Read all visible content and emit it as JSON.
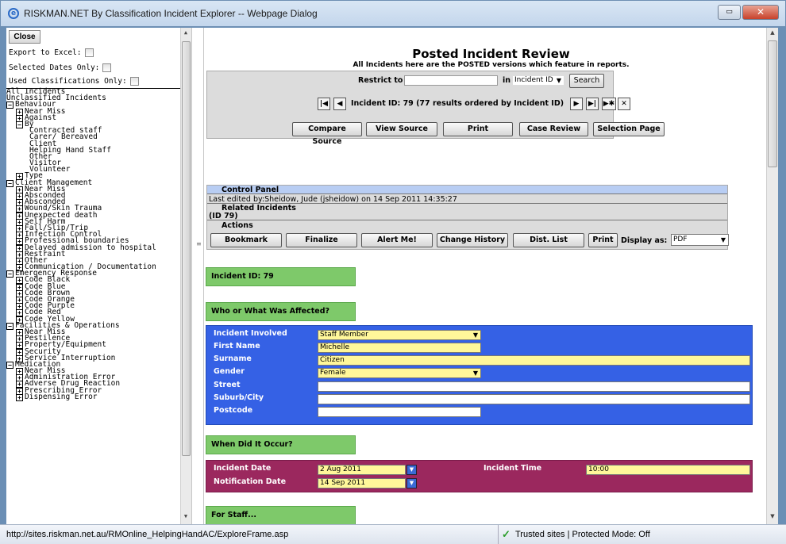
{
  "window": {
    "title": "RISKMAN.NET By Classification Incident Explorer -- Webpage Dialog",
    "close_symbol": "✕",
    "restore_symbol": "▭"
  },
  "left": {
    "close_label": "Close",
    "options": [
      "Export to Excel:",
      "Selected Dates Only:",
      "Used Classifications Only:"
    ],
    "tree": [
      {
        "t": "All Incidents",
        "lv": 0,
        "ex": ""
      },
      {
        "t": "Unclassified Incidents",
        "lv": 0,
        "ex": ""
      },
      {
        "t": "Behaviour",
        "lv": 0,
        "ex": "−"
      },
      {
        "t": "Near Miss",
        "lv": 1,
        "ex": "+"
      },
      {
        "t": "Against",
        "lv": 1,
        "ex": "+"
      },
      {
        "t": "By",
        "lv": 1,
        "ex": "−"
      },
      {
        "t": "Contracted staff",
        "lv": 2,
        "ex": ""
      },
      {
        "t": "Carer/ Bereaved",
        "lv": 2,
        "ex": ""
      },
      {
        "t": "Client",
        "lv": 2,
        "ex": ""
      },
      {
        "t": "Helping Hand Staff",
        "lv": 2,
        "ex": ""
      },
      {
        "t": "Other",
        "lv": 2,
        "ex": ""
      },
      {
        "t": "Visitor",
        "lv": 2,
        "ex": ""
      },
      {
        "t": "Volunteer",
        "lv": 2,
        "ex": ""
      },
      {
        "t": "Type",
        "lv": 1,
        "ex": "+"
      },
      {
        "t": "Client Management",
        "lv": 0,
        "ex": "−"
      },
      {
        "t": "Near Miss",
        "lv": 1,
        "ex": "+"
      },
      {
        "t": "Absconded",
        "lv": 1,
        "ex": "+"
      },
      {
        "t": "Absconded",
        "lv": 1,
        "ex": "+"
      },
      {
        "t": "Wound/Skin Trauma",
        "lv": 1,
        "ex": "+"
      },
      {
        "t": "Unexpected death",
        "lv": 1,
        "ex": "+"
      },
      {
        "t": "Self Harm",
        "lv": 1,
        "ex": "+"
      },
      {
        "t": "Fall/Slip/Trip",
        "lv": 1,
        "ex": "+"
      },
      {
        "t": "Infection Control",
        "lv": 1,
        "ex": "+"
      },
      {
        "t": "Professional boundaries",
        "lv": 1,
        "ex": "+"
      },
      {
        "t": "Delayed admission to hospital",
        "lv": 1,
        "ex": "+"
      },
      {
        "t": "Restraint",
        "lv": 1,
        "ex": "+"
      },
      {
        "t": "Other",
        "lv": 1,
        "ex": "+"
      },
      {
        "t": "Communication / Documentation",
        "lv": 1,
        "ex": "+"
      },
      {
        "t": "Emergency Response",
        "lv": 0,
        "ex": "−"
      },
      {
        "t": "Code Black",
        "lv": 1,
        "ex": "+"
      },
      {
        "t": "Code Blue",
        "lv": 1,
        "ex": "+"
      },
      {
        "t": "Code Brown",
        "lv": 1,
        "ex": "+"
      },
      {
        "t": "Code Orange",
        "lv": 1,
        "ex": "+"
      },
      {
        "t": "Code Purple",
        "lv": 1,
        "ex": "+"
      },
      {
        "t": "Code Red",
        "lv": 1,
        "ex": "+"
      },
      {
        "t": "Code Yellow",
        "lv": 1,
        "ex": "+"
      },
      {
        "t": "Facilities & Operations",
        "lv": 0,
        "ex": "−"
      },
      {
        "t": "Near Miss",
        "lv": 1,
        "ex": "+"
      },
      {
        "t": "Pestilence",
        "lv": 1,
        "ex": "+"
      },
      {
        "t": "Property/Equipment",
        "lv": 1,
        "ex": "+"
      },
      {
        "t": "Security",
        "lv": 1,
        "ex": "+"
      },
      {
        "t": "Service Interruption",
        "lv": 1,
        "ex": "+"
      },
      {
        "t": "Medication",
        "lv": 0,
        "ex": "−"
      },
      {
        "t": "Near Miss",
        "lv": 1,
        "ex": "+"
      },
      {
        "t": "Administration Error",
        "lv": 1,
        "ex": "+"
      },
      {
        "t": "Adverse Drug Reaction",
        "lv": 1,
        "ex": "+"
      },
      {
        "t": "Prescribing Error",
        "lv": 1,
        "ex": "+"
      },
      {
        "t": "Dispensing Error",
        "lv": 1,
        "ex": "+"
      }
    ]
  },
  "main": {
    "title": "Posted Incident Review",
    "subtitle": "All Incidents here are the POSTED versions which feature in reports.",
    "restrict_label": "Restrict to",
    "in_label": "in",
    "restrict_field": "Incident ID",
    "search_label": "Search",
    "nav_text": "Incident ID: 79 (77 results ordered by Incident ID)",
    "nav": {
      "first": "|◀",
      "prev": "◀",
      "next": "▶",
      "last": "▶|",
      "new": "▶✱",
      "delete": "✕"
    },
    "toolbar": [
      "Compare Source",
      "View Source",
      "Print",
      "Case Review",
      "Selection Page"
    ],
    "control_panel": {
      "heading": "Control Panel",
      "edited": "Last edited by:Sheidow, Jude (jsheidow) on 14 Sep 2011 14:35:27",
      "related_heading": "Related Incidents",
      "related_id": "(ID 79)",
      "actions_heading": "Actions",
      "actions": [
        "Bookmark",
        "Finalize",
        "Alert Me!",
        "Change History",
        "Dist. List",
        "Print"
      ],
      "display_as_label": "Display as:",
      "display_as_value": "PDF"
    },
    "sections": {
      "incident_id": "Incident ID: 79",
      "affected": "Who or What Was Affected?",
      "when": "When Did It Occur?",
      "staff": "For Staff..."
    },
    "affected": {
      "labels": [
        "Incident Involved",
        "First Name",
        "Surname",
        "Gender",
        "Street",
        "Suburb/City",
        "Postcode"
      ],
      "incident_involved": "Staff Member",
      "first_name": "Michelle",
      "surname": "Citizen",
      "gender": "Female",
      "street": "",
      "suburb": "",
      "postcode": ""
    },
    "when": {
      "incident_date_label": "Incident Date",
      "incident_date": "2 Aug 2011",
      "notification_date_label": "Notification Date",
      "notification_date": "14 Sep 2011",
      "incident_time_label": "Incident Time",
      "incident_time": "10:00"
    },
    "colors": {
      "green": "#7ec96a",
      "blue": "#3561e5",
      "purple": "#9b285e",
      "yellow": "#fff79a"
    }
  },
  "status": {
    "url": "http://sites.riskman.net.au/RMOnline_HelpingHandAC/ExploreFrame.asp",
    "zone": "Trusted sites | Protected Mode: Off"
  }
}
